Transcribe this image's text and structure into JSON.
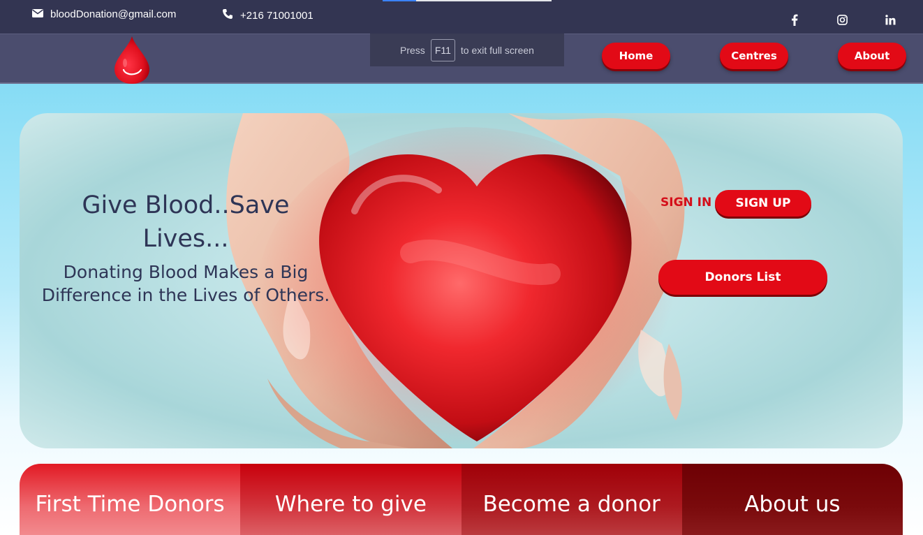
{
  "contact": {
    "email": "bloodDonation@gmail.com",
    "phone": "+216 71001001",
    "email_icon": "envelope-icon",
    "phone_icon": "phone-icon"
  },
  "social": [
    "facebook-icon",
    "instagram-icon",
    "linkedin-icon"
  ],
  "fullscreen_notice": {
    "press": "Press",
    "key": "F11",
    "rest": "to exit full screen"
  },
  "nav": {
    "home": "Home",
    "centres": "Centres",
    "about": "About"
  },
  "hero": {
    "title": "Give Blood..Save Lives...",
    "subtitle": "Donating Blood Makes a Big Difference in the Lives of Others.",
    "sign_in": "SIGN IN",
    "sign_up": "SIGN UP",
    "donors_list": "Donors List"
  },
  "cards": [
    "First Time Donors",
    "Where to give",
    "Become a donor",
    "About us"
  ],
  "colors": {
    "accent": "#e20a16",
    "topbar": "#333552",
    "navbar": "#4b4d6e",
    "text_dark": "#2e3556"
  }
}
